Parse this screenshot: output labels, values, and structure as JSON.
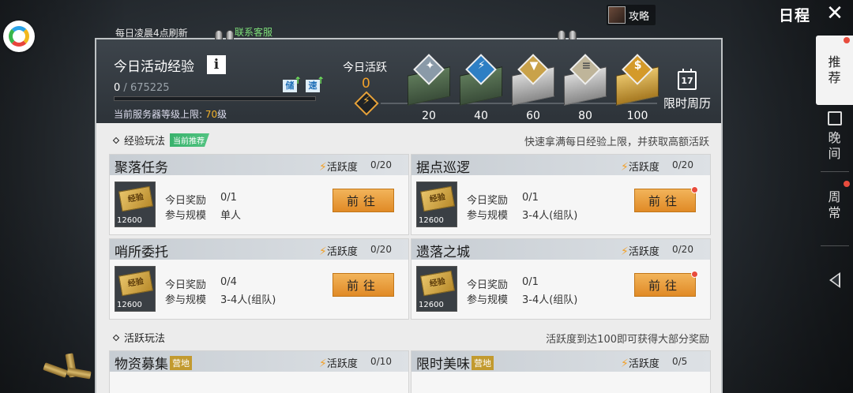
{
  "top": {
    "refresh_note": "每日凌晨4点刷新",
    "contact": "联系客服",
    "guide": "攻略",
    "title": "日程"
  },
  "side_tabs": [
    {
      "label": "推\n荐",
      "active": true
    },
    {
      "label": "晚\n间"
    },
    {
      "label": "周\n常"
    }
  ],
  "exp": {
    "title": "今日活动经验",
    "info": "i",
    "current": "0",
    "max": "675225",
    "badge_store": "储",
    "badge_speed": "速",
    "server_cap_label": "当前服务器等级上限:",
    "server_cap_value": "70",
    "server_cap_unit": "级"
  },
  "active": {
    "label": "今日活跃",
    "value": "0",
    "milestones": [
      "20",
      "40",
      "60",
      "80",
      "100"
    ],
    "weekly_day": "17",
    "weekly_label": "限时周历"
  },
  "sections": {
    "exp_play": {
      "title": "经验玩法",
      "tag": "当前推荐",
      "note": "快速拿满每日经验上限，并获取高额活跃"
    },
    "active_play": {
      "title": "活跃玩法",
      "note": "活跃度到达100即可获得大部分奖励"
    }
  },
  "labels": {
    "active_degree": "活跃度",
    "today_reward": "今日奖励",
    "scale": "参与规模",
    "go": "前往",
    "ticket_text": "经验",
    "ticket_amount": "12600"
  },
  "cards": [
    {
      "title": "聚落任务",
      "count": "0/20",
      "reward": "0/1",
      "scale": "单人"
    },
    {
      "title": "据点巡逻",
      "count": "0/20",
      "reward": "0/1",
      "scale": "3-4人(组队)"
    },
    {
      "title": "哨所委托",
      "count": "0/20",
      "reward": "0/4",
      "scale": "3-4人(组队)"
    },
    {
      "title": "遗落之城",
      "count": "0/20",
      "reward": "0/1",
      "scale": "3-4人(组队)"
    }
  ],
  "cards_bottom": [
    {
      "title": "物资募集",
      "badge": "营地",
      "count": "0/10"
    },
    {
      "title": "限时美味",
      "badge": "营地",
      "count": "0/5"
    }
  ],
  "colors": {
    "accent": "#e08a26",
    "active_value": "#f2a12a",
    "green": "#38b26c"
  }
}
